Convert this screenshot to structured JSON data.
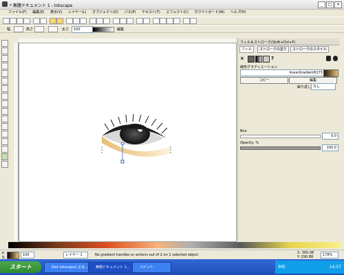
{
  "window": {
    "title": "* 無題ドキュメント 1 - Inkscape",
    "buttons": {
      "minimize": "_",
      "maximize": "□",
      "close": "×"
    }
  },
  "menubar": [
    "ファイル(F)",
    "編集(E)",
    "表示(V)",
    "レイヤー(L)",
    "オブジェクト(O)",
    "パス(P)",
    "テキスト(T)",
    "エフェクト(C)",
    "ホワイトボード(W)",
    "ヘルプ(H)"
  ],
  "controls_bar": {
    "width_label": "幅",
    "height_label": "高さ",
    "stroke_label": "太さ",
    "stroke_value": "100",
    "opacity_label": "編集"
  },
  "panel": {
    "title": "フィル＆ストローク(Shift+Ctrl+F)",
    "tabs": [
      "フィル",
      "ストロークの塗り",
      "ストロークのスタイル"
    ],
    "fill_type_icons": [
      "×",
      "■",
      "□",
      "■",
      "?"
    ],
    "gradient_section_label": "線形グラディエーション",
    "gradient_name": "linearGradient6173",
    "buttons": {
      "duplicate": "コピー",
      "edit": "編集"
    },
    "repeat_label": "繰り返し:",
    "repeat_value": "なし",
    "blur_label": "Blur",
    "blur_value": "0.0",
    "opacity_label": "Opacity, %",
    "opacity_value": "100.0"
  },
  "statusbar": {
    "coordinates": "X: 305.08",
    "coordinates_y": "Y: 290.88",
    "zoom": "178%",
    "layer_value": "レイヤー 1",
    "message": "No gradient handles or actions out of 2 on 1 selected object",
    "fill_label": "F:",
    "stroke_label": "S:",
    "opacity_field": "100"
  },
  "taskbar": {
    "start_label": "スタート",
    "tasks": [
      "Rad Inkscapeによる...",
      "無題ドキュメント 1...",
      "ペイント"
    ],
    "clock": "14:57",
    "ime": "IME"
  },
  "colors": {
    "accent": "#3168d5",
    "start_green": "#3a9a3a",
    "eye_dark": "#1a1a1a",
    "skin": "#e6c07a"
  }
}
